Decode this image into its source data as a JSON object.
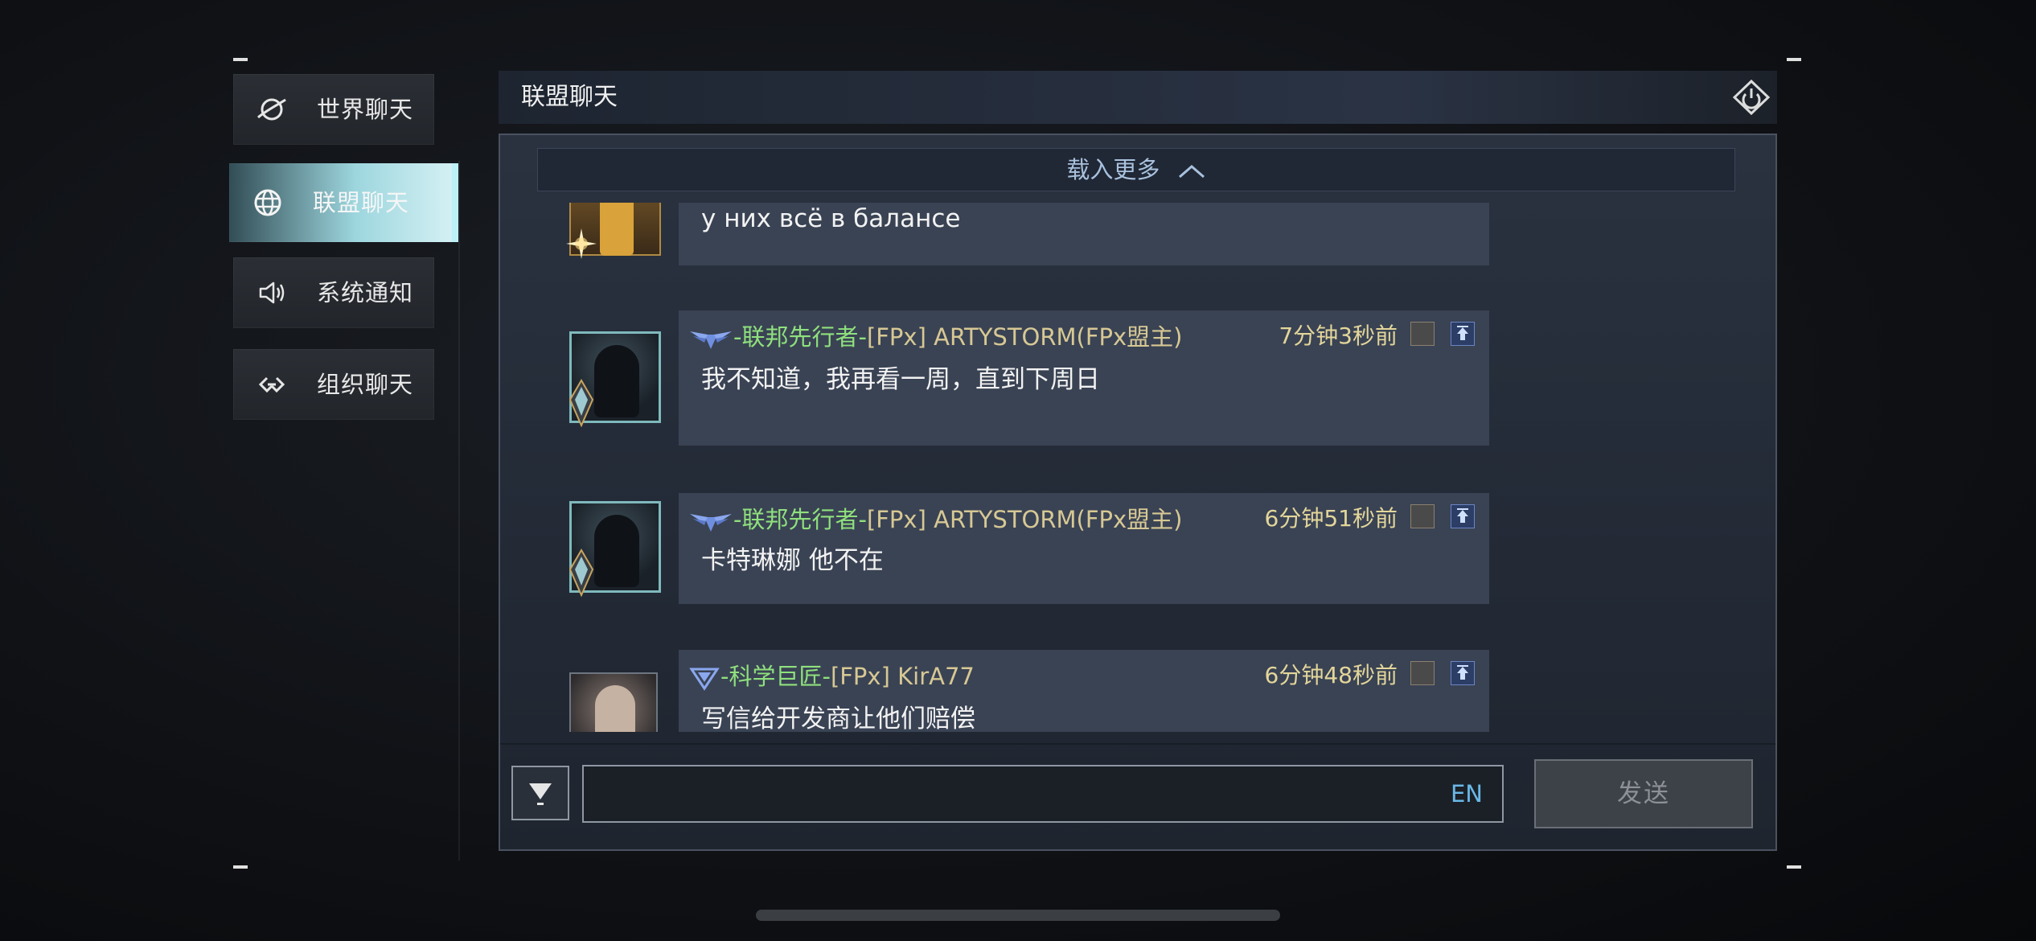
{
  "tabs": [
    {
      "label": "世界聊天",
      "icon": "planet-icon",
      "active": false
    },
    {
      "label": "联盟聊天",
      "icon": "globe-icon",
      "active": true
    },
    {
      "label": "系统通知",
      "icon": "speaker-icon",
      "active": false
    },
    {
      "label": "组织聊天",
      "icon": "link-icon",
      "active": false
    }
  ],
  "header": {
    "title": "联盟聊天",
    "exit_icon": "power-icon"
  },
  "load_more": {
    "label": "载入更多"
  },
  "messages": [
    {
      "text": "у них всё в балансе"
    },
    {
      "rank": "-联邦先行者-",
      "tag": "[FPx] ARTYSTORM(FPx盟主)",
      "time": "7分钟3秒前",
      "text": "我不知道，我再看一周，直到下周日"
    },
    {
      "rank": "-联邦先行者-",
      "tag": "[FPx] ARTYSTORM(FPx盟主)",
      "time": "6分钟51秒前",
      "text": "卡特琳娜 他不在"
    },
    {
      "rank": "-科学巨匠-",
      "tag": "[FPx] KirA77",
      "time": "6分钟48秒前",
      "text": "写信给开发商让他们赔偿"
    }
  ],
  "input": {
    "value": "",
    "lang": "EN"
  },
  "send": {
    "label": "发送"
  },
  "colors": {
    "accent": "#9dd6de",
    "rank_green": "#8fe07d",
    "tag_gold": "#d7c894",
    "time_gold": "#e3d69a",
    "lang_blue": "#69b8e6"
  }
}
